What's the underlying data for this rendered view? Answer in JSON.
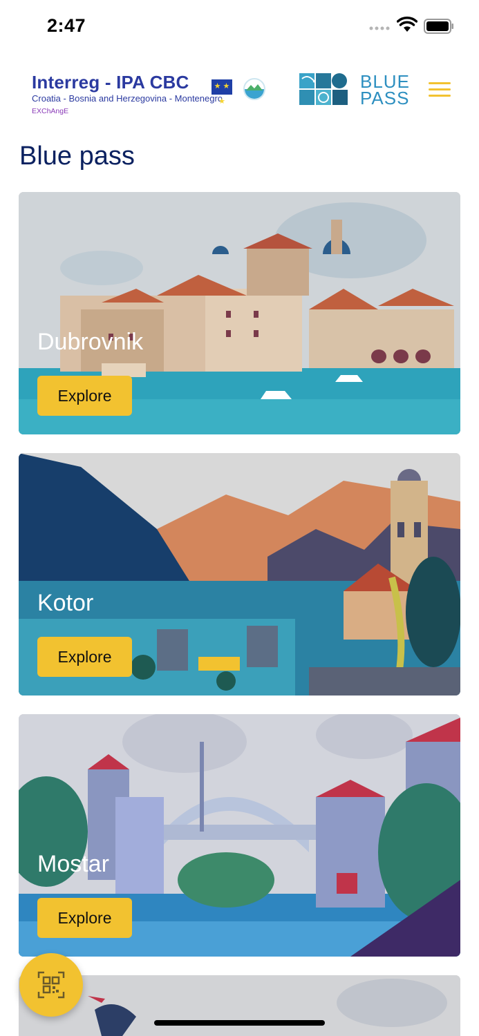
{
  "status_bar": {
    "time": "2:47"
  },
  "header": {
    "interreg_title": "Interreg - IPA CBC",
    "interreg_subtitle": "Croatia - Bosnia and Herzegovina - Montenegro",
    "interreg_tag": "EXChAngE",
    "bluepass_logo": [
      "BLUE",
      "PASS"
    ]
  },
  "page": {
    "title": "Blue pass"
  },
  "cards": [
    {
      "city": "Dubrovnik",
      "button": "Explore"
    },
    {
      "city": "Kotor",
      "button": "Explore"
    },
    {
      "city": "Mostar",
      "button": "Explore"
    }
  ],
  "icons": {
    "menu": "hamburger-menu-icon",
    "fab": "qr-code-icon",
    "wifi": "wifi-icon",
    "battery": "battery-icon",
    "signal": "cellular-signal-icon"
  },
  "colors": {
    "accent": "#f2c230",
    "title": "#0b2160",
    "sea": "#2ea3bb"
  }
}
